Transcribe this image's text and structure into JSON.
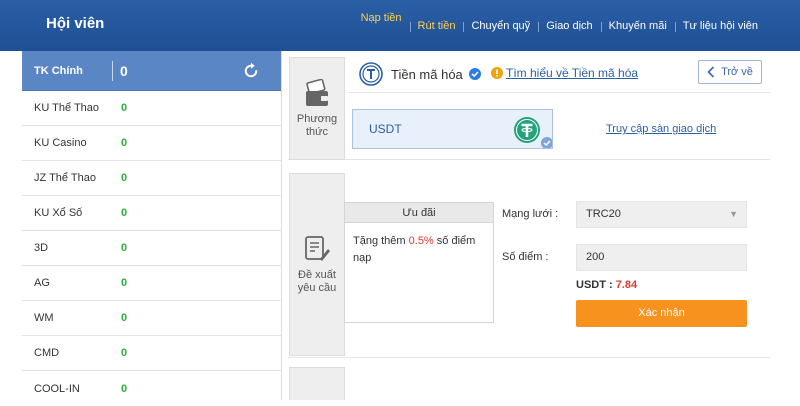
{
  "header": {
    "title": "Hội viên",
    "nav": [
      "Nạp tiền",
      "Rút tiền",
      "Chuyển quỹ",
      "Giao dịch",
      "Khuyến mãi",
      "Tư liệu hội viên"
    ]
  },
  "sidebar": {
    "main": {
      "label": "TK Chính",
      "value": "0"
    },
    "items": [
      {
        "label": "KU Thể Thao",
        "value": "0"
      },
      {
        "label": "KU Casino",
        "value": "0"
      },
      {
        "label": "JZ Thể Thao",
        "value": "0"
      },
      {
        "label": "KU Xổ Số",
        "value": "0"
      },
      {
        "label": "3D",
        "value": "0"
      },
      {
        "label": "AG",
        "value": "0"
      },
      {
        "label": "WM",
        "value": "0"
      },
      {
        "label": "CMD",
        "value": "0"
      },
      {
        "label": "COOL-IN",
        "value": "0"
      }
    ]
  },
  "tabs": {
    "method": "Phương thức",
    "request": "Đề xuất yêu cầu"
  },
  "crypto": {
    "title": "Tiền mã hóa",
    "learn_link": "Tìm hiểu về Tiền mã hóa",
    "back": "Trở về",
    "currency": "USDT",
    "exchange_link": "Truy cập sàn giao dịch"
  },
  "promo": {
    "head": "Ưu đãi",
    "text_before": "Tặng thêm ",
    "percent": "0.5%",
    "text_after": " số điểm nạp"
  },
  "form": {
    "network_label": "Mạng lưới :",
    "network_value": "TRC20",
    "points_label": "Số điểm :",
    "points_value": "200",
    "usdt_label": "USDT : ",
    "usdt_value": "7.84",
    "confirm": "Xác nhận"
  },
  "colors": {
    "header": "#1f4f94",
    "accent_gold": "#ffd34a",
    "value_green": "#2fae3a",
    "confirm_orange": "#f7921e",
    "highlight_red": "#e03a2f"
  }
}
